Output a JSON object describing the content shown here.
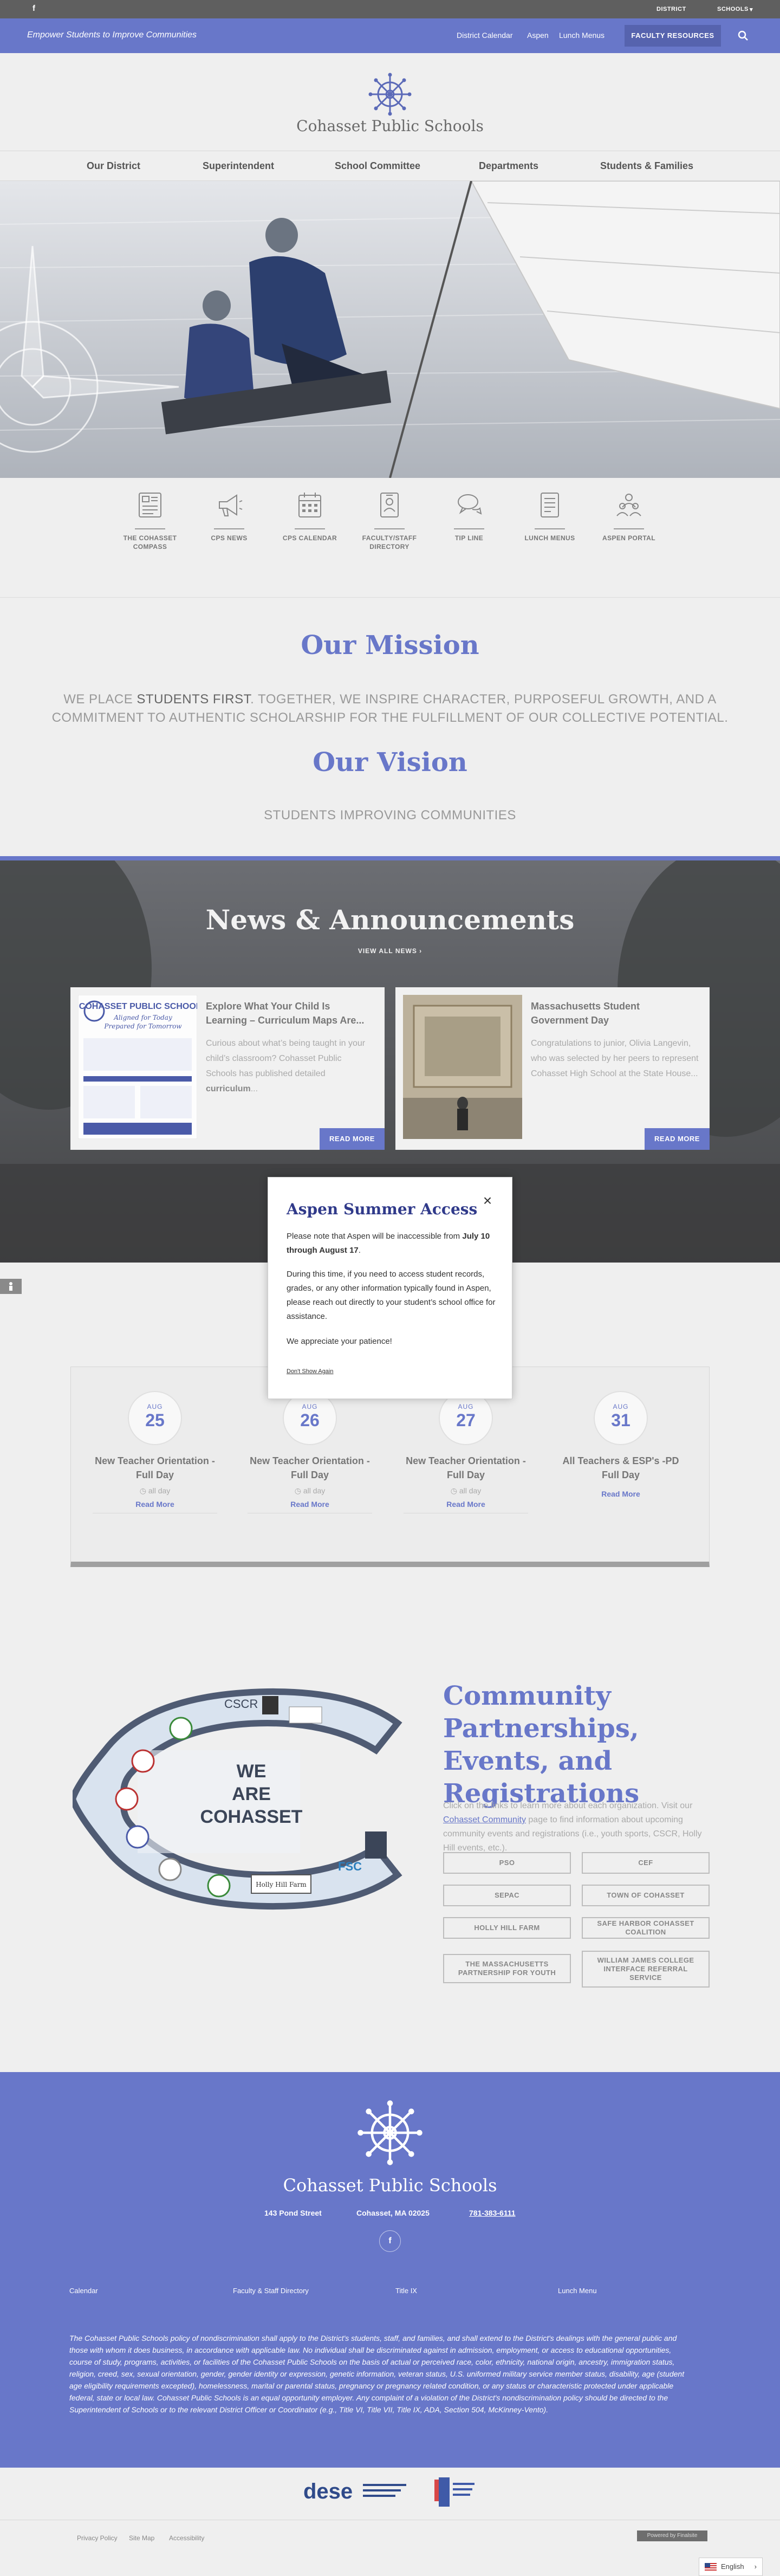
{
  "utility": {
    "facebook": "f",
    "district": "DISTRICT",
    "schools": "SCHOOLS"
  },
  "topbar": {
    "tagline": "Empower Students to Improve Communities",
    "links": [
      "District Calendar",
      "Aspen",
      "Lunch Menus"
    ],
    "faculty": "FACULTY RESOURCES"
  },
  "site": {
    "name": "Cohasset Public Schools"
  },
  "nav": [
    "Our District",
    "Superintendent",
    "School Committee",
    "Departments",
    "Students & Families"
  ],
  "quicklinks": [
    {
      "label": "THE COHASSET COMPASS",
      "icon": "newspaper-icon"
    },
    {
      "label": "CPS NEWS",
      "icon": "megaphone-icon"
    },
    {
      "label": "CPS CALENDAR",
      "icon": "calendar-icon"
    },
    {
      "label": "FACULTY/STAFF DIRECTORY",
      "icon": "id-badge-icon"
    },
    {
      "label": "TIP LINE",
      "icon": "chat-icon"
    },
    {
      "label": "LUNCH MENUS",
      "icon": "menu-icon"
    },
    {
      "label": "ASPEN PORTAL",
      "icon": "people-icon"
    }
  ],
  "mission": {
    "title": "Our Mission",
    "text_before": "WE PLACE ",
    "text_strong": "STUDENTS FIRST",
    "text_after": ". TOGETHER, WE INSPIRE CHARACTER, PURPOSEFUL GROWTH, AND A COMMITMENT TO AUTHENTIC SCHOLARSHIP FOR THE FULFILLMENT OF OUR COLLECTIVE POTENTIAL.",
    "vision_title": "Our Vision",
    "vision_text": "STUDENTS IMPROVING COMMUNITIES"
  },
  "news": {
    "title": "News & Announcements",
    "view_all": "VIEW ALL NEWS",
    "cards": [
      {
        "title": "Explore What Your Child Is Learning – Curriculum Maps Are...",
        "body": "Curious about what’s being taught in your child’s classroom? Cohasset Public Schools has published detailed ",
        "body_strong": "curriculum",
        "body_end": "...",
        "more": "READ MORE",
        "thumb_title": "COHASSET PUBLIC SCHOOLS",
        "thumb_sub1": "Aligned for Today",
        "thumb_sub2": "Prepared for Tomorrow"
      },
      {
        "title": "Massachusetts Student Government Day",
        "body": "Congratulations to junior, Olivia Langevin, who was selected by her peers to represent Cohasset High School at the State House...",
        "more": "READ MORE"
      }
    ]
  },
  "events": [
    {
      "mon": "AUG",
      "day": "25",
      "title": "New Teacher Orientation - Full Day",
      "time": "all day",
      "more": "Read More"
    },
    {
      "mon": "AUG",
      "day": "26",
      "title": "New Teacher Orientation - Full Day",
      "time": "all day",
      "more": "Read More"
    },
    {
      "mon": "AUG",
      "day": "27",
      "title": "New Teacher Orientation - Full Day",
      "time": "all day",
      "more": "Read More"
    },
    {
      "mon": "AUG",
      "day": "31",
      "title": "All Teachers & ESP's -PD Full Day",
      "time": "",
      "more": "Read More"
    }
  ],
  "modal": {
    "title": "Aspen Summer Access",
    "p1_before": "Please note that Aspen will be inaccessible from ",
    "p1_strong": "July 10 through August 17",
    "p1_after": ".",
    "p2": "During this time, if you need to access student records, grades, or any other information typically found in Aspen, please reach out directly to your student’s school office for assistance.",
    "p3": "We appreciate your patience!",
    "dont_show": "Don't Show Again",
    "close": "×"
  },
  "community": {
    "title": "Community Partnerships, Events, and Registrations",
    "text_before": "Click on the links to learn more about each organization. Visit our ",
    "text_link": "Cohasset Community",
    "text_after": " page to find information about upcoming community events and registrations (i.e., youth sports, CSCR, Holly Hill events, etc.).",
    "we_are_1": "WE",
    "we_are_2": "ARE",
    "we_are_3": "COHASSET",
    "badge_cscr": "CSCR",
    "badge_hill": "Holly Hill Farm",
    "badge_fsc": "FSC",
    "buttons": [
      "PSO",
      "CEF",
      "SEPAC",
      "TOWN OF COHASSET",
      "HOLLY HILL FARM",
      "SAFE HARBOR COHASSET COALITION",
      "THE MASSACHUSETTS PARTNERSHIP FOR YOUTH",
      "WILLIAM JAMES COLLEGE INTERFACE REFERRAL SERVICE"
    ]
  },
  "footer": {
    "name": "Cohasset Public Schools",
    "address": "143 Pond Street",
    "city": "Cohasset, MA 02025",
    "phone": "781-383-6111",
    "facebook": "f",
    "links": [
      "Calendar",
      "Faculty & Staff Directory",
      "Title IX",
      "Lunch Menu"
    ],
    "legal": "The Cohasset Public Schools policy of nondiscrimination shall apply to the District's students, staff, and families, and shall extend to the District's dealings with the general public and those with whom it does business, in accordance with applicable law. No individual shall be discriminated against in admission, employment, or access to educational opportunities, course of study, programs, activities, or facilities of the Cohasset Public Schools on the basis of actual or perceived race, color, ethnicity, national origin, ancestry, immigration status, religion, creed, sex, sexual orientation, gender, gender identity or expression, genetic information, veteran status, U.S. uniformed military service member status, disability, age (student age eligibility requirements excepted), homelessness, marital or parental status, pregnancy or pregnancy related condition, or any status or characteristic protected under applicable federal, state or local law. Cohasset Public Schools is an equal opportunity employer. Any complaint of a violation of the District's nondiscrimination policy should be directed to the Superintendent of Schools or to the relevant District Officer or Coordinator (e.g., Title VI, Title VII, Title IX, ADA, Section 504, McKinney-Vento)."
  },
  "logos": {
    "dese": "dese"
  },
  "bottom": {
    "links": [
      "Privacy Policy",
      "Site Map",
      "Accessibility"
    ],
    "powered": "Powered by Finalsite",
    "lang": "English"
  }
}
